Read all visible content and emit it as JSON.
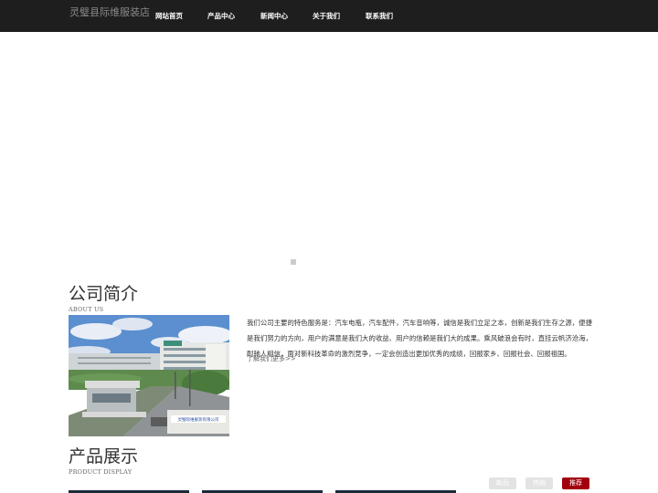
{
  "header": {
    "site_name": "灵璧县际维服装店",
    "nav": [
      "网站首页",
      "产品中心",
      "新闻中心",
      "关于我们",
      "联系我们"
    ]
  },
  "about": {
    "title": "公司简介",
    "subtitle": "ABOUT US",
    "photo_label": "灵璧际维服装有限公司",
    "text": "我们公司主要的特色服务是：汽车电瓶，汽车配件，汽车音响等，诚信是我们立足之本，创新是我们生存之源，便捷是我们努力的方向，用户的满意是我们大的收益、用户的信赖是我们大的成果。乘风破浪会有时，直挂云帆济沧海，耐驰人相信，面对新科技革命的激烈竞争，一定会创造出更加优秀的成绩，回报家乡、回报社会、回报祖国。",
    "more": "了解我们更多>>"
  },
  "products": {
    "title": "产品展示",
    "subtitle": "PRODUCT DISPLAY",
    "tabs": [
      "新品",
      "热销",
      "推荐"
    ],
    "active_tab": "推荐"
  },
  "colors": {
    "header_bg": "#1e1e1e",
    "accent": "#a3000d"
  }
}
